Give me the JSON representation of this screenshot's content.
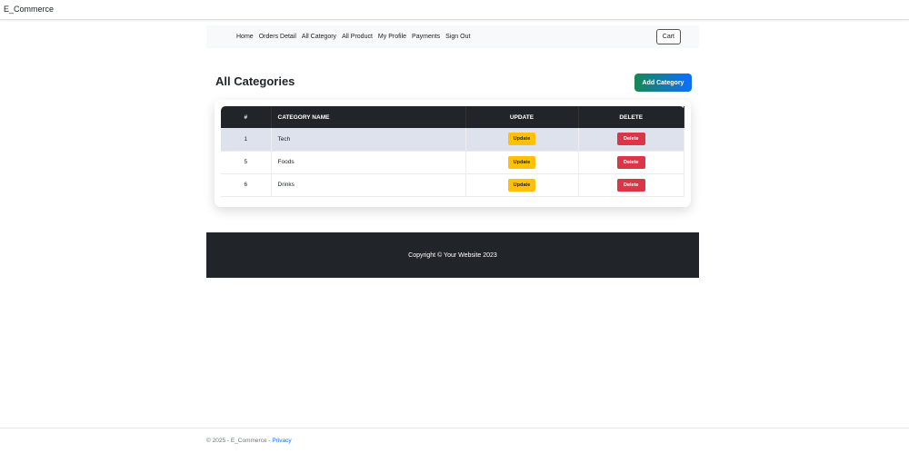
{
  "app": {
    "title": "E_Commerce"
  },
  "nav": {
    "items": [
      "Home",
      "Orders Detail",
      "All Category",
      "All Product",
      "My Profile",
      "Payments",
      "Sign Out"
    ],
    "cart": "Cart"
  },
  "page": {
    "title": "All Categories",
    "add_button": "Add Category"
  },
  "table": {
    "headers": [
      "#",
      "CATEGORY NAME",
      "UPDATE",
      "DELETE"
    ],
    "rows": [
      {
        "id": "1",
        "name": "Tech",
        "update": "Update",
        "delete": "Delete"
      },
      {
        "id": "5",
        "name": "Foods",
        "update": "Update",
        "delete": "Delete"
      },
      {
        "id": "6",
        "name": "Drinks",
        "update": "Update",
        "delete": "Delete"
      }
    ]
  },
  "footer": {
    "copyright": "Copyright © Your Website 2023"
  },
  "bottom": {
    "text": "© 2025 - E_Commerce - ",
    "privacy": "Privacy"
  }
}
